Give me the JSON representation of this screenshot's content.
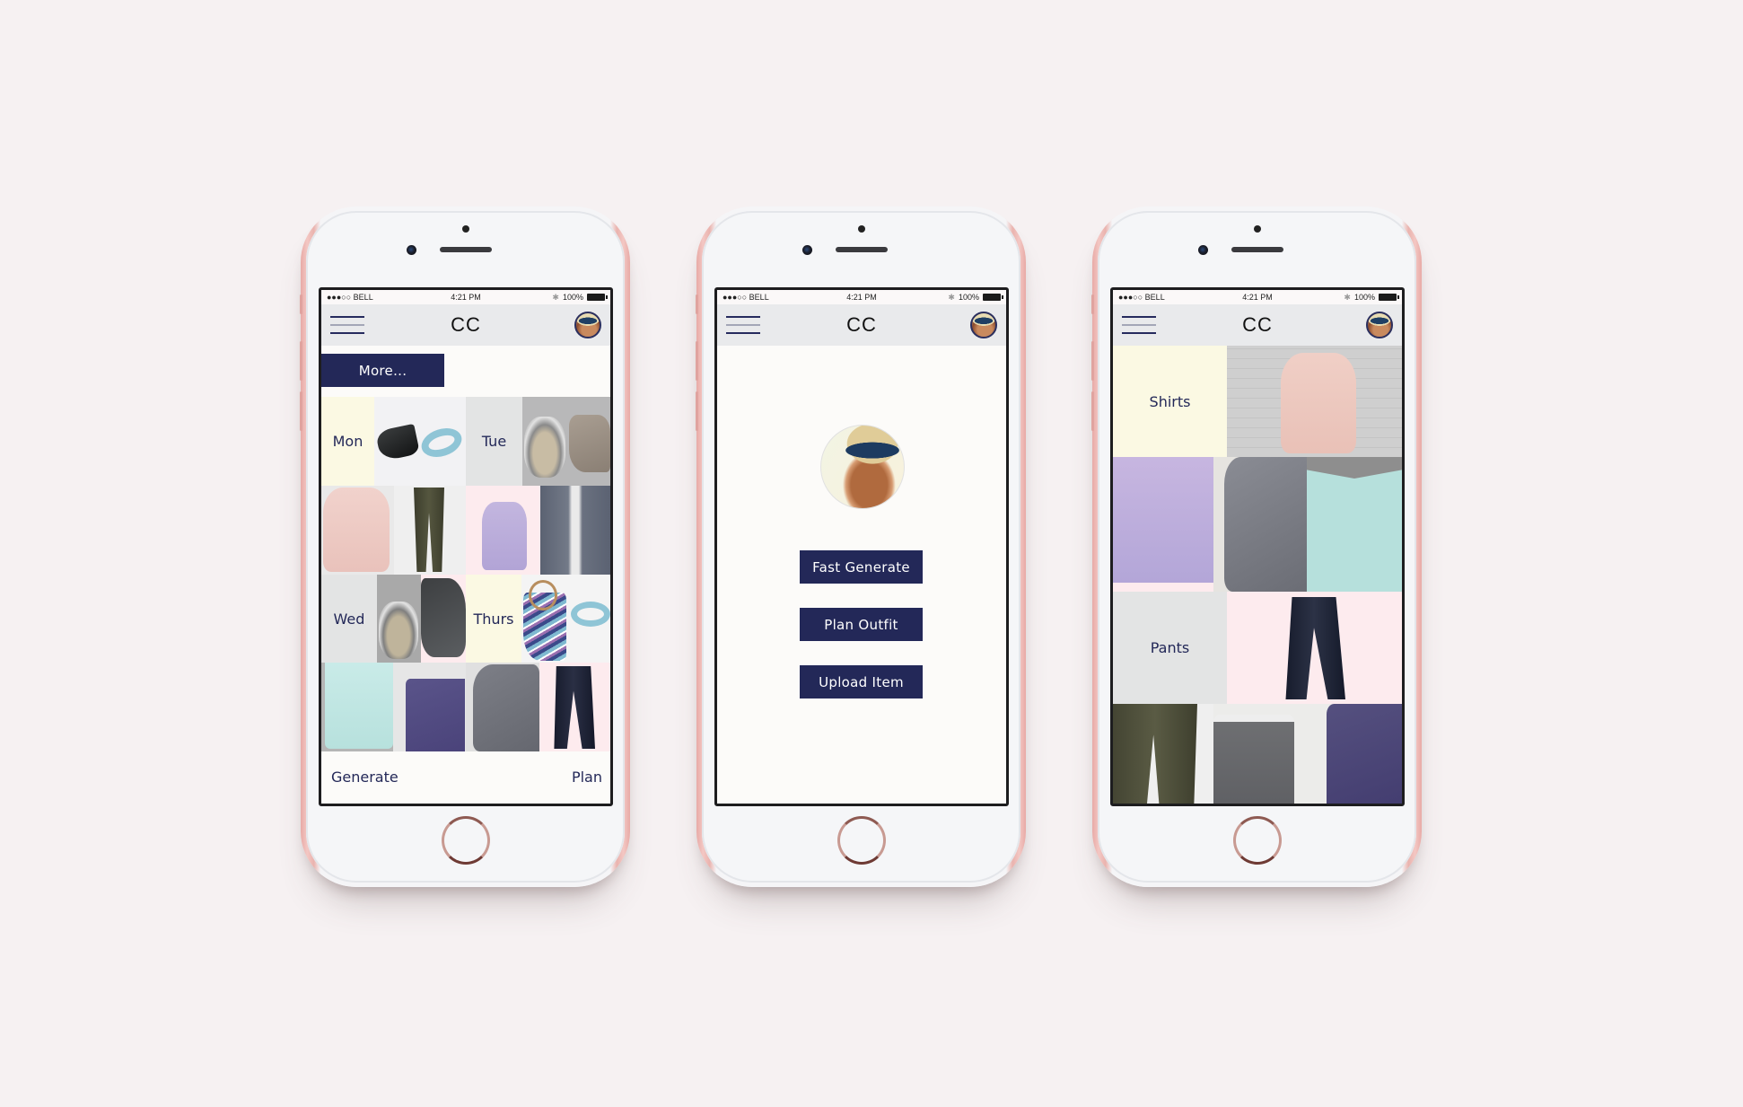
{
  "colors": {
    "background": "#f6f1f2",
    "navy": "#232858",
    "cream": "#fbf9e3",
    "light_gray": "#e3e4e4",
    "pink": "#fdebee",
    "header_bg": "#e9eaec"
  },
  "status_bar": {
    "carrier": "●●●○○ BELL",
    "wifi_icon": "wifi-icon",
    "time": "4:21 PM",
    "bluetooth_icon": "bluetooth-icon",
    "battery": "100%"
  },
  "app": {
    "title": "CC",
    "menu_icon": "hamburger-menu-icon",
    "avatar_icon": "profile-avatar"
  },
  "screens": {
    "planner": {
      "more_button": "More...",
      "days": [
        {
          "label": "Mon",
          "items": [
            "black heels",
            "blue scarf",
            "pink top",
            "olive jeans"
          ]
        },
        {
          "label": "Tue",
          "items": [
            "silver bracelet",
            "taupe booties",
            "lavender top",
            "gray trousers"
          ]
        },
        {
          "label": "Wed",
          "items": [
            "silver bracelet",
            "gray sneakers",
            "mint top",
            "purple trousers"
          ]
        },
        {
          "label": "Thurs",
          "items": [
            "striped wedges",
            "blue scarf",
            "gray shirt",
            "black jeans"
          ]
        }
      ],
      "footer": {
        "left": "Generate",
        "right": "Plan"
      }
    },
    "home": {
      "buttons": [
        "Fast Generate",
        "Plan Outfit",
        "Upload Item"
      ]
    },
    "closet": {
      "categories": [
        {
          "label": "Shirts",
          "items": [
            "pink top",
            "lavender top",
            "gray shirt",
            "mint top"
          ]
        },
        {
          "label": "Pants",
          "items": [
            "black jeans",
            "olive jeans",
            "gray trousers",
            "purple trousers"
          ]
        }
      ]
    }
  }
}
